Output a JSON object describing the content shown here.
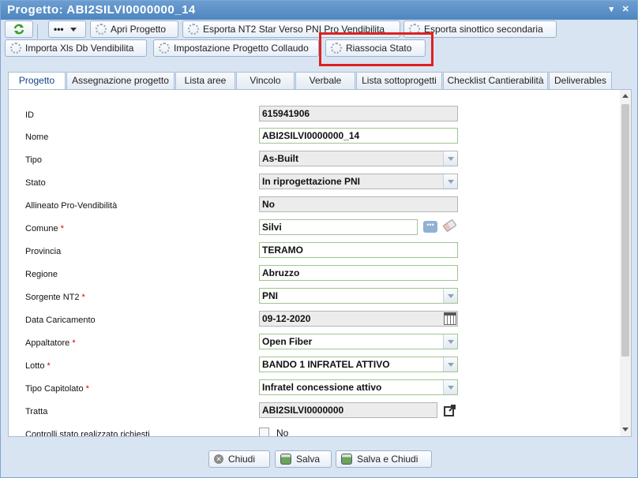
{
  "window": {
    "title": "Progetto: ABI2SILVI0000000_14"
  },
  "toolbar": {
    "refresh_icon": "refresh-icon",
    "more_label": "•••",
    "buttons": [
      "Apri Progetto",
      "Esporta NT2 Star Verso PNI Pro Vendibilita",
      "Esporta sinottico secondaria",
      "Importa Xls Db Vendibilita",
      "Impostazione Progetto Collaudo",
      "Riassocia Stato"
    ]
  },
  "tabs": [
    "Progetto",
    "Assegnazione progetto",
    "Lista aree",
    "Vincolo",
    "Verbale",
    "Lista sottoprogetti",
    "Checklist Cantierabilità",
    "Deliverables"
  ],
  "fields": {
    "id": {
      "label": "ID",
      "value": "615941906"
    },
    "nome": {
      "label": "Nome",
      "value": "ABI2SILVI0000000_14"
    },
    "tipo": {
      "label": "Tipo",
      "value": "As-Built"
    },
    "stato": {
      "label": "Stato",
      "value": "In riprogettazione PNI"
    },
    "allineato": {
      "label": "Allineato Pro-Vendibilità",
      "value": "No"
    },
    "comune": {
      "label": "Comune",
      "value": "Silvi"
    },
    "provincia": {
      "label": "Provincia",
      "value": "TERAMO"
    },
    "regione": {
      "label": "Regione",
      "value": "Abruzzo"
    },
    "sorgente": {
      "label": "Sorgente NT2",
      "value": "PNI"
    },
    "data": {
      "label": "Data Caricamento",
      "value": "09-12-2020"
    },
    "appaltatore": {
      "label": "Appaltatore",
      "value": "Open Fiber"
    },
    "lotto": {
      "label": "Lotto",
      "value": "BANDO 1 INFRATEL ATTIVO"
    },
    "capitolato": {
      "label": "Tipo Capitolato",
      "value": "Infratel concessione attivo"
    },
    "tratta": {
      "label": "Tratta",
      "value": "ABI2SILVI0000000"
    },
    "controlli": {
      "label": "Controlli stato realizzato richiesti",
      "value": "No"
    }
  },
  "footer": {
    "close": "Chiudi",
    "save": "Salva",
    "save_close": "Salva e Chiudi"
  },
  "colors": {
    "accent": "#4f86c0",
    "highlight": "#e02020"
  }
}
